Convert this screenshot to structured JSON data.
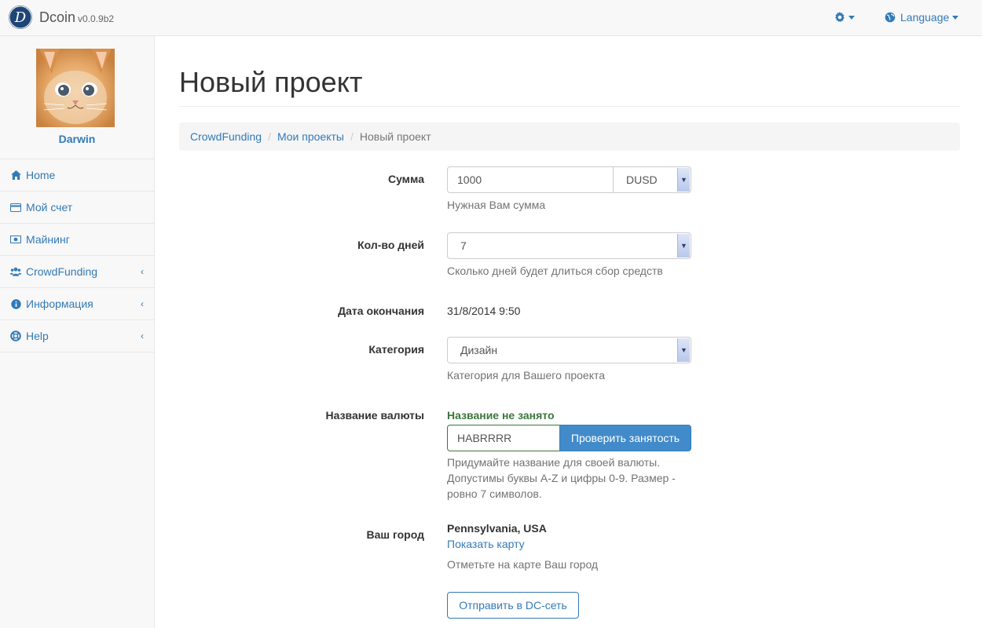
{
  "app": {
    "brand": "Dcoin",
    "version": "v0.0.9b2",
    "logo_letter": "D"
  },
  "topbar": {
    "language_label": "Language",
    "settings_icon": "gear-icon",
    "language_icon": "globe-icon"
  },
  "sidebar": {
    "username": "Darwin",
    "items": [
      {
        "label": "Home",
        "icon": "home-icon"
      },
      {
        "label": "Мой счет",
        "icon": "credit-card-icon"
      },
      {
        "label": "Майнинг",
        "icon": "money-icon"
      },
      {
        "label": "CrowdFunding",
        "icon": "users-icon",
        "has_submenu": true
      },
      {
        "label": "Информация",
        "icon": "info-icon",
        "has_submenu": true
      },
      {
        "label": "Help",
        "icon": "life-ring-icon",
        "has_submenu": true
      }
    ],
    "chevron": "‹"
  },
  "page": {
    "title": "Новый проект",
    "breadcrumb": [
      "CrowdFunding",
      "Мои проекты",
      "Новый проект"
    ]
  },
  "form": {
    "amount": {
      "label": "Сумма",
      "value": "1000",
      "currency": "DUSD",
      "help": "Нужная Вам сумма"
    },
    "days": {
      "label": "Кол-во дней",
      "value": "7",
      "help": "Сколько дней будет длиться сбор средств"
    },
    "end_date": {
      "label": "Дата окончания",
      "value": "31/8/2014 9:50"
    },
    "category": {
      "label": "Категория",
      "value": "Дизайн",
      "help": "Категория для Вашего проекта"
    },
    "currency_name": {
      "label": "Название валюты",
      "status": "Название не занято",
      "value": "HABRRRR",
      "check_button": "Проверить занятость",
      "help_lines": [
        "Придумайте название для своей валюты.",
        "Допустимы буквы A-Z и цифры 0-9. Размер -",
        "ровно 7 символов."
      ]
    },
    "city": {
      "label": "Ваш город",
      "value": "Pennsylvania, USA",
      "map_link": "Показать карту",
      "help": "Отметьте на карте Ваш город"
    },
    "submit_button": "Отправить в DC-сеть"
  },
  "colors": {
    "link": "#337ab7",
    "primary": "#428bca",
    "success": "#3c763d",
    "logo_bg": "#1f4577"
  }
}
